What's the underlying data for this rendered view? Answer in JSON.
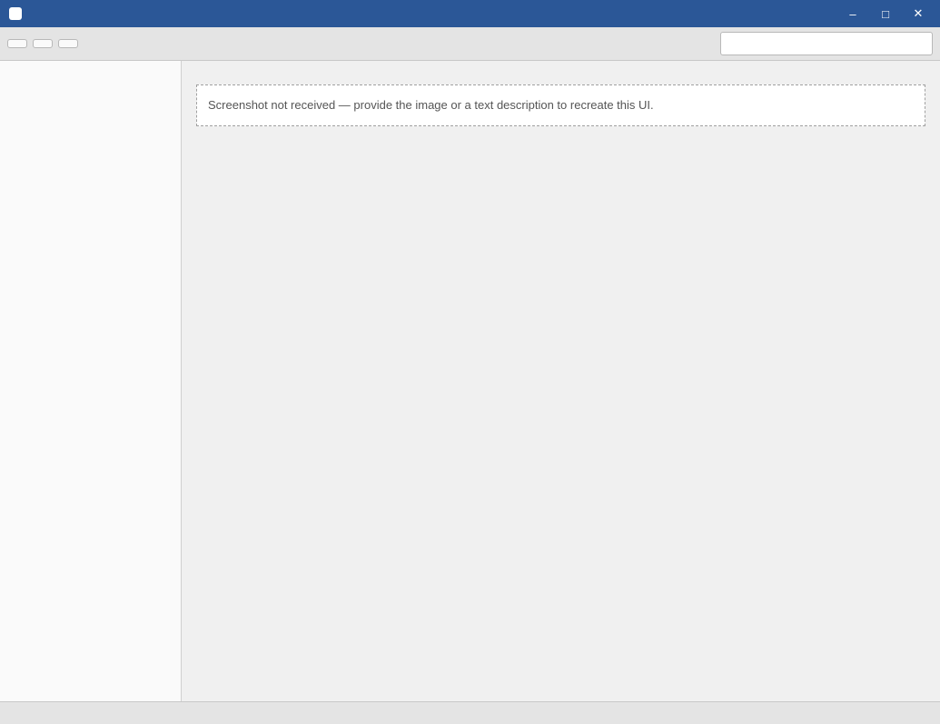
{
  "window": {
    "title": ""
  },
  "toolbar": {
    "buttons": [
      "",
      "",
      ""
    ],
    "search_placeholder": ""
  },
  "sidebar": {
    "items": [
      "",
      "",
      "",
      ""
    ]
  },
  "main": {
    "title": "",
    "notice": "Screenshot not received — provide the image or a text description to recreate this UI."
  },
  "status": {
    "text": ""
  }
}
